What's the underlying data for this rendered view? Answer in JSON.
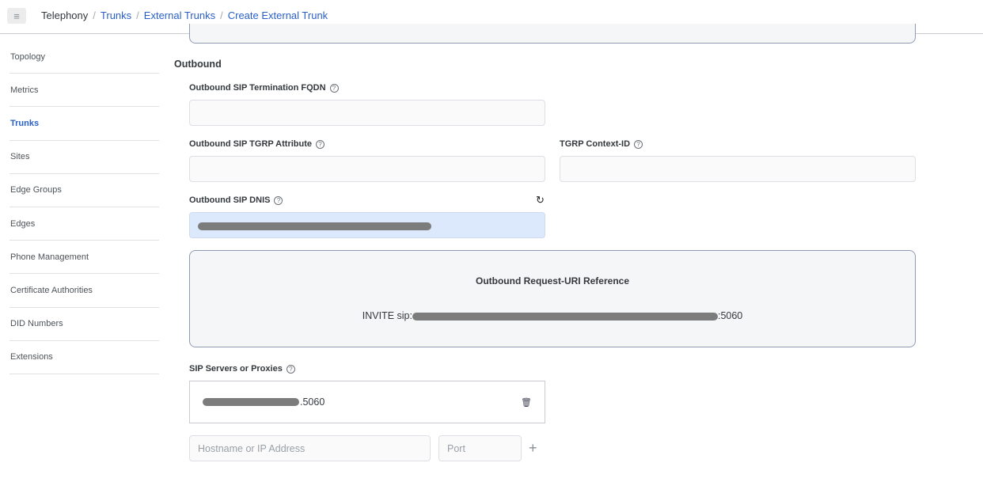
{
  "header": {
    "menu_icon": "hamburger-menu-icon",
    "breadcrumb": {
      "root": "Telephony",
      "links": [
        "Trunks",
        "External Trunks",
        "Create External Trunk"
      ],
      "separator": "/"
    }
  },
  "sidebar": {
    "active": "Trunks",
    "items": [
      {
        "label": "Topology"
      },
      {
        "label": "Metrics"
      },
      {
        "label": "Trunks"
      },
      {
        "label": "Sites"
      },
      {
        "label": "Edge Groups"
      },
      {
        "label": "Edges"
      },
      {
        "label": "Phone Management"
      },
      {
        "label": "Certificate Authorities"
      },
      {
        "label": "DID Numbers"
      },
      {
        "label": "Extensions"
      }
    ]
  },
  "outbound": {
    "section_title": "Outbound",
    "termination_fqdn": {
      "label": "Outbound SIP Termination FQDN",
      "value": ""
    },
    "tgrp_attribute": {
      "label": "Outbound SIP TGRP Attribute",
      "value": ""
    },
    "tgrp_context_id": {
      "label": "TGRP Context-ID",
      "value": ""
    },
    "dnis": {
      "label": "Outbound SIP DNIS",
      "value": "[redacted]",
      "reset_icon": "reset-icon"
    },
    "request_uri": {
      "title": "Outbound Request-URI Reference",
      "prefix": "INVITE sip:",
      "suffix": ":5060"
    },
    "sip_servers": {
      "label": "SIP Servers or Proxies",
      "entries": [
        {
          "value_visible_suffix": ".5060"
        }
      ],
      "host_placeholder": "Hostname or IP Address",
      "port_placeholder": "Port",
      "add_icon": "+"
    }
  },
  "icons": {
    "help": "?",
    "menu": "≡",
    "reset": "↻",
    "trash": "🗑",
    "add": "+"
  },
  "colors": {
    "accent": "#2a60c8",
    "filled_input_bg": "#dce8fc",
    "card_bg": "#f5f6f8",
    "card_border": "#8f9bb3"
  }
}
